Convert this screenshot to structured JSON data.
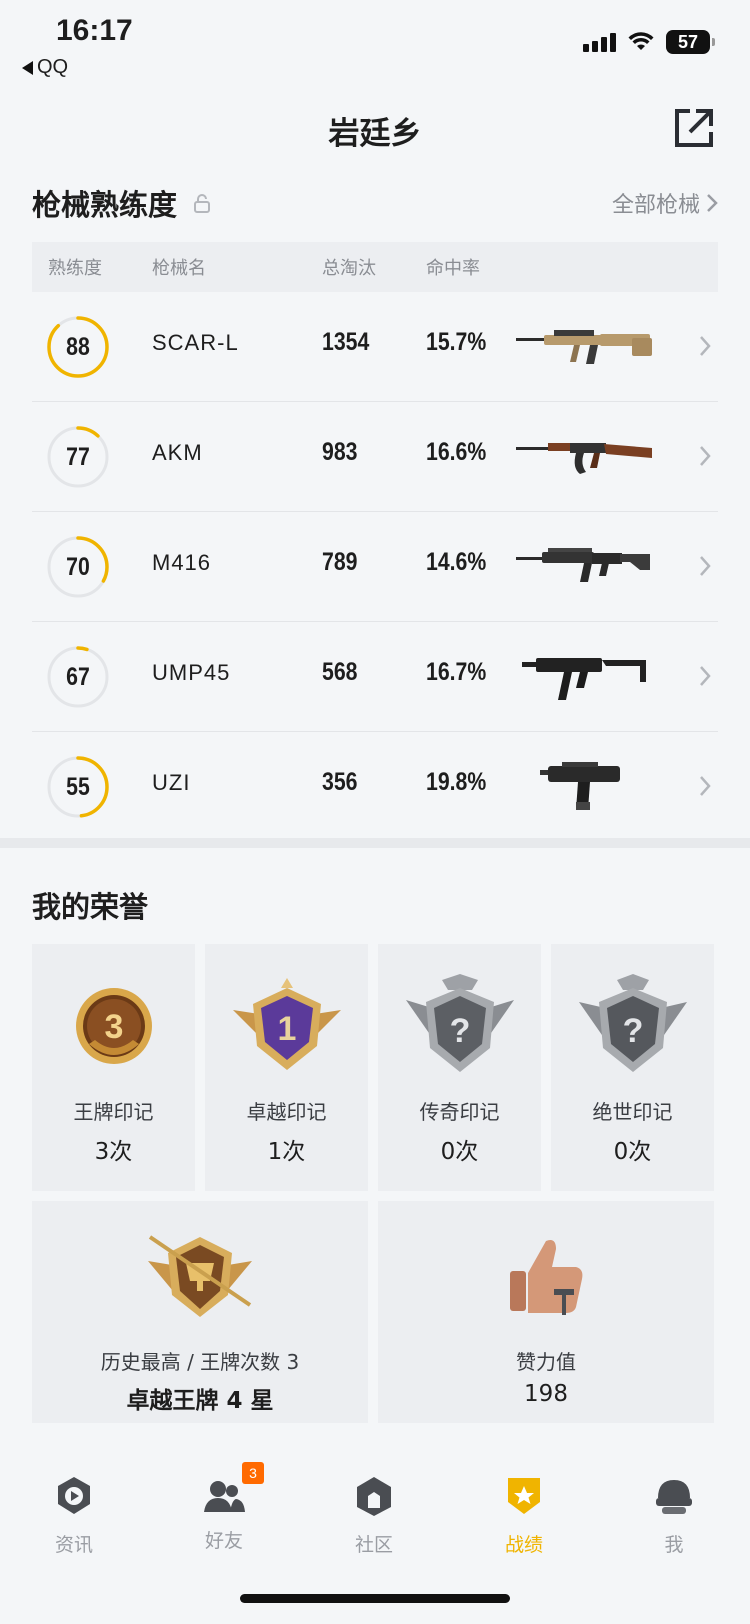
{
  "status_bar": {
    "time": "16:17",
    "back_app": "QQ",
    "battery": "57"
  },
  "header": {
    "title": "岩廷乡"
  },
  "weapons_section": {
    "title": "枪械熟练度",
    "all_link": "全部枪械",
    "columns": [
      "熟练度",
      "枪械名",
      "总淘汰",
      "命中率"
    ],
    "rows": [
      {
        "mastery": "88",
        "name": "SCAR-L",
        "kills": "1354",
        "hit_rate": "15.7%",
        "progress": 0.88,
        "gun_icon": "rifle-tan-icon"
      },
      {
        "mastery": "77",
        "name": "AKM",
        "kills": "983",
        "hit_rate": "16.6%",
        "progress": 0.12,
        "gun_icon": "rifle-wood-icon"
      },
      {
        "mastery": "70",
        "name": "M416",
        "kills": "789",
        "hit_rate": "14.6%",
        "progress": 0.33,
        "gun_icon": "rifle-black-icon"
      },
      {
        "mastery": "67",
        "name": "UMP45",
        "kills": "568",
        "hit_rate": "16.7%",
        "progress": 0.05,
        "gun_icon": "smg-icon"
      },
      {
        "mastery": "55",
        "name": "UZI",
        "kills": "356",
        "hit_rate": "19.8%",
        "progress": 0.48,
        "gun_icon": "machine-pistol-icon"
      }
    ]
  },
  "honors_section": {
    "title": "我的荣誉",
    "marks": [
      {
        "label": "王牌印记",
        "value": "3次",
        "badge_text": "3"
      },
      {
        "label": "卓越印记",
        "value": "1次",
        "badge_text": "1"
      },
      {
        "label": "传奇印记",
        "value": "0次",
        "badge_text": "?"
      },
      {
        "label": "绝世印记",
        "value": "0次",
        "badge_text": "?"
      }
    ],
    "highest": {
      "label": "历史最高 / 王牌次数 3",
      "value": "卓越王牌 4 星"
    },
    "likes": {
      "label": "赞力值",
      "value": "198"
    }
  },
  "tab_bar": {
    "tabs": [
      {
        "label": "资讯",
        "icon": "news-icon"
      },
      {
        "label": "好友",
        "icon": "friends-icon",
        "badge": "3"
      },
      {
        "label": "社区",
        "icon": "community-icon"
      },
      {
        "label": "战绩",
        "icon": "record-icon",
        "active": true
      },
      {
        "label": "我",
        "icon": "profile-icon"
      }
    ]
  },
  "colors": {
    "accent": "#f0b400",
    "ring_track": "#e3e5e8",
    "background": "#f4f6f8"
  }
}
